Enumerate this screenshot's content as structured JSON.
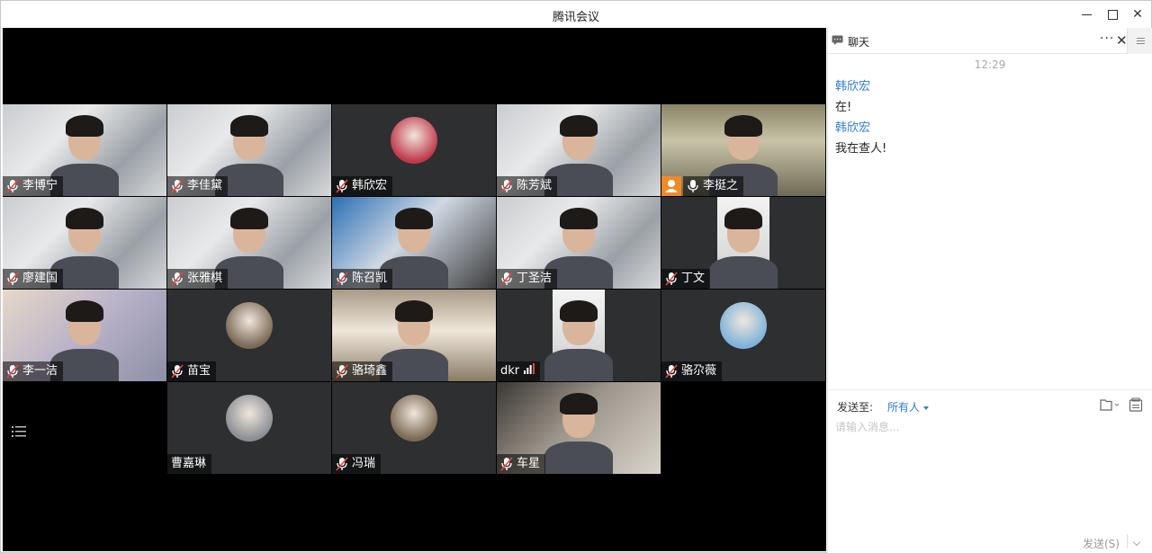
{
  "window": {
    "title": "腾讯会议"
  },
  "participants": [
    {
      "name": "李博宁",
      "mic": "muted",
      "video": "on",
      "bg": "room"
    },
    {
      "name": "李佳黛",
      "mic": "muted",
      "video": "on",
      "bg": "room"
    },
    {
      "name": "韩欣宏",
      "mic": "muted",
      "video": "off",
      "bg": "avatar"
    },
    {
      "name": "陈芳斌",
      "mic": "muted",
      "video": "on",
      "bg": "room"
    },
    {
      "name": "李挺之",
      "mic": "on",
      "video": "on",
      "bg": "office",
      "host": true,
      "active": true
    },
    {
      "name": "廖建国",
      "mic": "muted",
      "video": "on",
      "bg": "room"
    },
    {
      "name": "张雅棋",
      "mic": "muted",
      "video": "on",
      "bg": "room"
    },
    {
      "name": "陈召凯",
      "mic": "muted",
      "video": "on",
      "bg": "blue-room"
    },
    {
      "name": "丁圣洁",
      "mic": "muted",
      "video": "on",
      "bg": "room"
    },
    {
      "name": "丁文",
      "mic": "muted",
      "video": "on",
      "bg": "narrow"
    },
    {
      "name": "李一洁",
      "mic": "muted",
      "video": "on",
      "bg": "blur"
    },
    {
      "name": "苗宝",
      "mic": "muted",
      "video": "off",
      "bg": "avatar"
    },
    {
      "name": "骆琦鑫",
      "mic": "muted",
      "video": "on",
      "bg": "shelf"
    },
    {
      "name": "dkr",
      "mic": "signal",
      "video": "on",
      "bg": "narrow"
    },
    {
      "name": "骆尕薇",
      "mic": "muted",
      "video": "off",
      "bg": "avatar"
    },
    {
      "name": "曹嘉琳",
      "mic": "none",
      "video": "off",
      "bg": "avatar"
    },
    {
      "name": "冯瑞",
      "mic": "muted",
      "video": "off",
      "bg": "avatar"
    },
    {
      "name": "车星",
      "mic": "muted",
      "video": "on",
      "bg": "face"
    }
  ],
  "chat": {
    "title": "聊天",
    "time": "12:29",
    "messages": [
      {
        "sender": "韩欣宏",
        "text": "在!"
      },
      {
        "sender": "韩欣宏",
        "text": "我在查人!"
      }
    ],
    "send_to_label": "发送至:",
    "send_to_value": "所有人",
    "input_placeholder": "请输入消息...",
    "send_label": "发送(S)"
  },
  "colors": {
    "accent": "#2f7bd6",
    "host": "#f08a24",
    "active_border": "#3bb16b",
    "tile_bg": "#2e2f31"
  }
}
